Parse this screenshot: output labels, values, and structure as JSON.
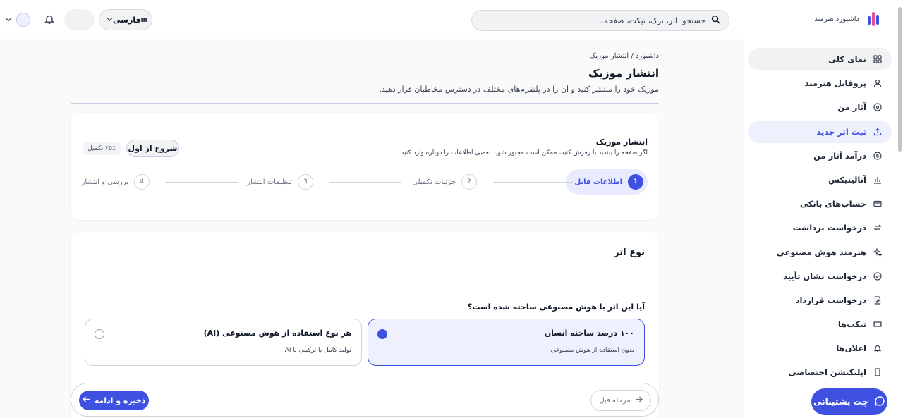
{
  "sidebar": {
    "brand": "داشبورد هنرمند",
    "items": [
      {
        "label": "نمای کلی",
        "icon": "grid-icon"
      },
      {
        "label": "پروفایل هنرمند",
        "icon": "user-icon"
      },
      {
        "label": "آثار من",
        "icon": "music-disc-icon"
      },
      {
        "label": "ثبت اثر جدید",
        "icon": "upload-icon"
      },
      {
        "label": "درآمد آثار من",
        "icon": "dollar-icon"
      },
      {
        "label": "آنالیتیکس",
        "icon": "bar-chart-icon"
      },
      {
        "label": "حساب‌های بانکی",
        "icon": "card-icon"
      },
      {
        "label": "درخواست برداشت",
        "icon": "transfer-icon"
      },
      {
        "label": "هنرمند هوش مصنوعی",
        "icon": "sparkles-icon"
      },
      {
        "label": "درخواست نشان تأیید",
        "icon": "check-circle-icon"
      },
      {
        "label": "درخواست قرارداد",
        "icon": "document-edit-icon"
      },
      {
        "label": "تیکت‌ها",
        "icon": "ticket-icon"
      },
      {
        "label": "اعلان‌ها",
        "icon": "bell-icon"
      },
      {
        "label": "اپلیکیشن اختصاصی",
        "icon": "phone-icon"
      }
    ],
    "chat_label": "چت پشتیبانی"
  },
  "topbar": {
    "search_placeholder": "جستجو: اثر، ترک، تیکت، صفحه...",
    "lang_label": "فارسی",
    "lang_code": "IR"
  },
  "page": {
    "breadcrumb": "داشبورد / انتشار موزیک",
    "title": "انتشار موزیک",
    "subtitle": "موزیک خود را منتشر کنید و آن را در پلتفرم‌های مختلف در دسترس مخاطبان قرار دهید."
  },
  "steps_card": {
    "title": "انتشار موزیک",
    "subtitle": "اگر صفحه را ببندید یا رفرش کنید، ممکن است مجبور شوید بعضی اطلاعات را دوباره وارد کنید.",
    "restart_label": "شروع از اول",
    "progress_label": "۲۵٪ تکمیل",
    "progress_percent": 25,
    "steps": [
      {
        "num": "1",
        "label": "اطلاعات فایل"
      },
      {
        "num": "2",
        "label": "جزئیات تکمیلی"
      },
      {
        "num": "3",
        "label": "تنظیمات انتشار"
      },
      {
        "num": "4",
        "label": "بررسی و انتشار"
      }
    ]
  },
  "type_card": {
    "title": "نوع اثر",
    "question": "آیا این اثر با هوش مصنوعی ساخته شده است؟",
    "options": [
      {
        "title": "۱۰۰ درصد ساخته انسان",
        "desc": "بدون استفاده از هوش مصنوعی",
        "selected": true
      },
      {
        "title": "هر نوع استفاده از هوش مصنوعی (AI)",
        "desc": "تولید کامل یا ترکیبی با AI",
        "selected": false
      }
    ]
  },
  "footer": {
    "prev_label": "مرحله قبل",
    "save_label": "ذخیره و ادامه"
  },
  "colors": {
    "accent": "#3f51e0",
    "accent_light": "#eef0fe"
  }
}
